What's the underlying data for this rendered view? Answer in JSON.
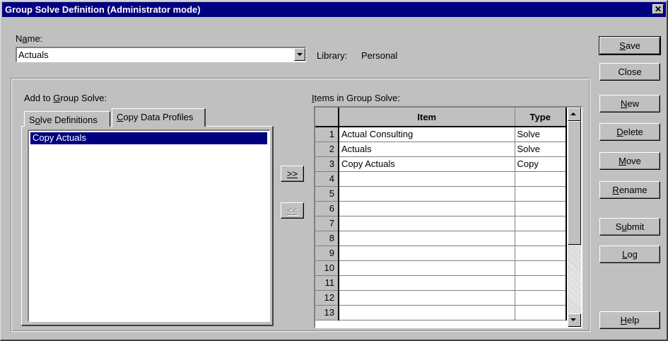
{
  "window": {
    "title": "Group Solve Definition (Administrator mode)",
    "close_glyph": "✕"
  },
  "name_field": {
    "label": "Name:",
    "value": "Actuals"
  },
  "library": {
    "label": "Library:",
    "value": "Personal"
  },
  "left_panel": {
    "label": "Add to Group Solve:",
    "tabs": [
      {
        "label": "Solve Definitions",
        "active": false
      },
      {
        "label": "Copy Data Profiles",
        "active": true
      }
    ],
    "list_items": [
      "Copy Actuals"
    ]
  },
  "transfer": {
    "add_label": ">>",
    "remove_label": "<<"
  },
  "right_panel": {
    "label": "Items in Group Solve:",
    "columns": [
      "Item",
      "Type"
    ],
    "rows": [
      {
        "n": "1",
        "item": "Actual Consulting",
        "type": "Solve"
      },
      {
        "n": "2",
        "item": "Actuals",
        "type": "Solve"
      },
      {
        "n": "3",
        "item": "Copy Actuals",
        "type": "Copy"
      },
      {
        "n": "4",
        "item": "",
        "type": ""
      },
      {
        "n": "5",
        "item": "",
        "type": ""
      },
      {
        "n": "6",
        "item": "",
        "type": ""
      },
      {
        "n": "7",
        "item": "",
        "type": ""
      },
      {
        "n": "8",
        "item": "",
        "type": ""
      },
      {
        "n": "9",
        "item": "",
        "type": ""
      },
      {
        "n": "10",
        "item": "",
        "type": ""
      },
      {
        "n": "11",
        "item": "",
        "type": ""
      },
      {
        "n": "12",
        "item": "",
        "type": ""
      },
      {
        "n": "13",
        "item": "",
        "type": ""
      }
    ]
  },
  "buttons": {
    "save": "Save",
    "close": "Close",
    "new": "New",
    "delete": "Delete",
    "move": "Move",
    "rename": "Rename",
    "submit": "Submit",
    "log": "Log",
    "help": "Help"
  },
  "colors": {
    "face": "#c0c0c0",
    "titlebar": "#000080",
    "selection": "#000080"
  }
}
